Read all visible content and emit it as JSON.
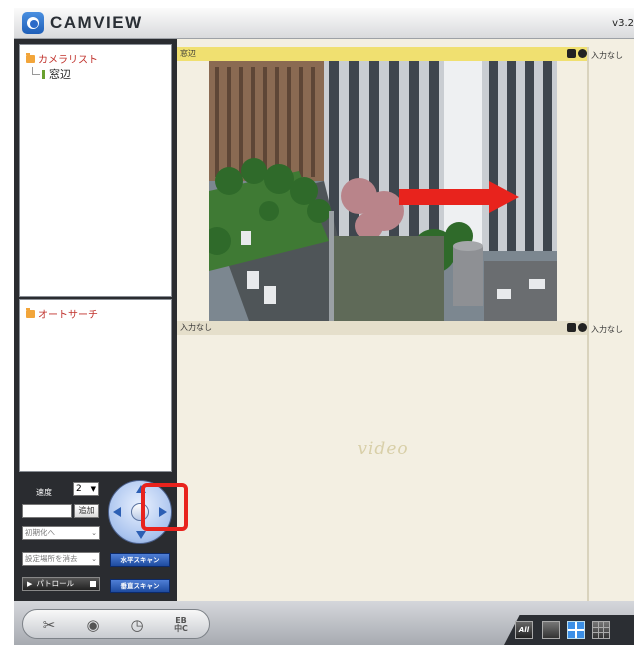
{
  "app": {
    "title": "CAMVIEW",
    "version": "v3.2"
  },
  "camera_list": {
    "header": "カメラリスト",
    "items": [
      {
        "label": "窓辺"
      }
    ]
  },
  "auto_search": {
    "header": "オートサーチ"
  },
  "controls": {
    "speed_label": "速度",
    "speed_value": "2",
    "add_button": "追加",
    "init_dropdown": "初期化へ",
    "preset_dropdown": "設定場所を消去",
    "patrol_button": "パトロール",
    "hscan_button": "水平スキャン",
    "vscan_button": "垂直スキャン"
  },
  "video": {
    "channels": [
      {
        "header": "窓辺",
        "side_label": "入力なし"
      },
      {
        "header": "入力なし",
        "side_label": "入力なし"
      }
    ],
    "placeholder": "video"
  },
  "bottom_toolbar": {
    "language_label_top": "EB",
    "language_label_bottom": "中C",
    "layout_all": "All"
  },
  "colors": {
    "active_header": "#f0e070",
    "inactive_header": "#e5dfcb",
    "highlight": "#e8231d",
    "accent_blue": "#3c8fe6"
  }
}
